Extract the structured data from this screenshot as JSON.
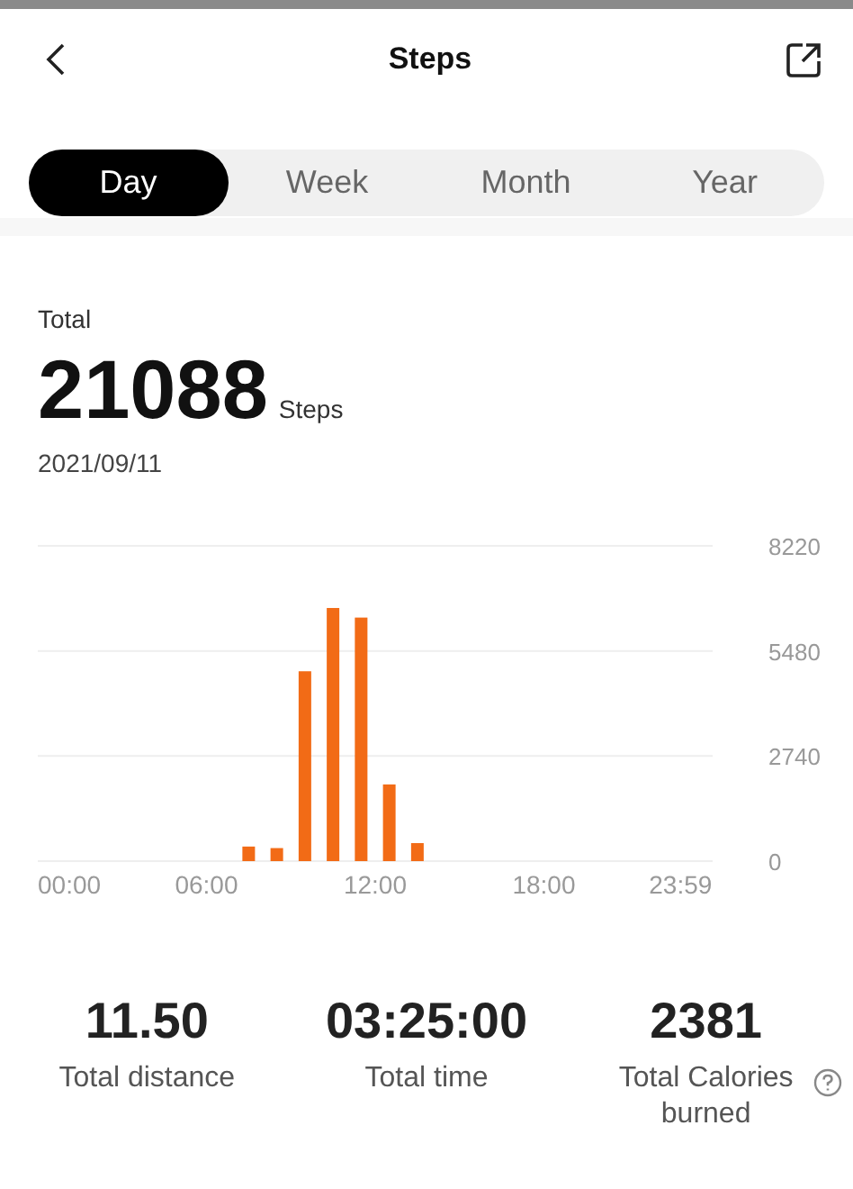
{
  "header": {
    "title": "Steps"
  },
  "tabs": [
    {
      "label": "Day",
      "selected": true
    },
    {
      "label": "Week",
      "selected": false
    },
    {
      "label": "Month",
      "selected": false
    },
    {
      "label": "Year",
      "selected": false
    }
  ],
  "summary": {
    "label": "Total",
    "value": "21088",
    "unit": "Steps",
    "date": "2021/09/11"
  },
  "chart_data": {
    "type": "bar",
    "x": [
      0.5,
      1.5,
      2.5,
      3.5,
      4.5,
      5.5,
      6.5,
      7.5,
      8.5,
      9.5,
      10.5,
      11.5,
      12.5,
      13.5,
      14.5,
      15.5,
      16.5,
      17.5,
      18.5,
      19.5,
      20.5,
      21.5,
      22.5,
      23.5
    ],
    "series": [
      {
        "color": "#f26b16",
        "values": [
          0,
          0,
          0,
          0,
          0,
          0,
          0,
          380,
          340,
          4950,
          6600,
          6350,
          2000,
          470,
          0,
          0,
          0,
          0,
          0,
          0,
          0,
          0,
          0,
          0
        ]
      }
    ],
    "xlim": [
      0,
      24
    ],
    "ylim": [
      0,
      8220
    ],
    "xticks": [
      {
        "value": 0,
        "label": "00:00"
      },
      {
        "value": 6,
        "label": "06:00"
      },
      {
        "value": 12,
        "label": "12:00"
      },
      {
        "value": 18,
        "label": "18:00"
      },
      {
        "value": 23.98,
        "label": "23:59"
      }
    ],
    "yticks": [
      0,
      2740,
      5480,
      8220
    ]
  },
  "stats": [
    {
      "value": "11.50",
      "label": "Total distance",
      "help": false
    },
    {
      "value": "03:25:00",
      "label": "Total time",
      "help": false
    },
    {
      "value": "2381",
      "label": "Total Calories burned",
      "help": true
    }
  ]
}
